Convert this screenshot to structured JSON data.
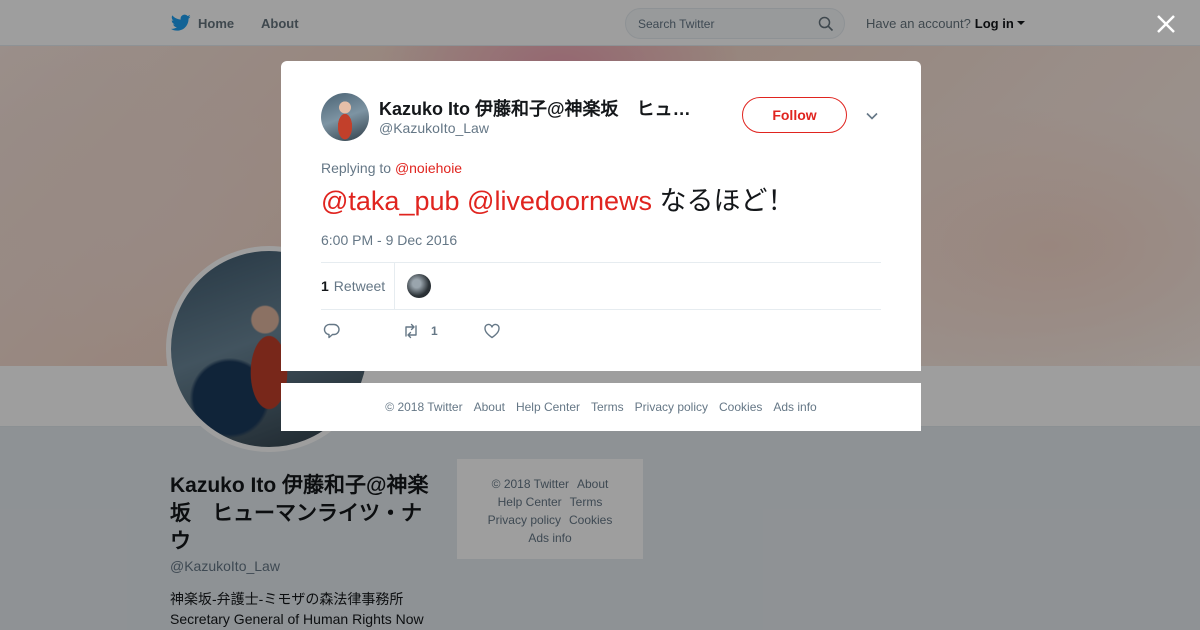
{
  "topbar": {
    "home_label": "Home",
    "about_label": "About",
    "search_placeholder": "Search Twitter",
    "have_account": "Have an account?",
    "login_label": "Log in"
  },
  "profile": {
    "name": "Kazuko Ito 伊藤和子@神楽坂　ヒューマンライツ・ナウ",
    "handle": "@KazukoIto_Law",
    "bio_line1": "神楽坂-弁護士-ミモザの森法律事務所",
    "bio_line2": "Secretary General of Human Rights Now"
  },
  "side_footer": {
    "copyright": "© 2018 Twitter",
    "about": "About",
    "help": "Help Center",
    "terms": "Terms",
    "privacy": "Privacy policy",
    "cookies": "Cookies",
    "ads": "Ads info"
  },
  "tweet": {
    "author_name": "Kazuko Ito 伊藤和子@神楽坂　ヒューマンライツ・ナウ",
    "author_handle": "@KazukoIto_Law",
    "follow_label": "Follow",
    "replying_prefix": "Replying to",
    "replying_to": "@noiehoie",
    "mention1": "@taka_pub",
    "mention2": "@livedoornews",
    "text": "なるほど！",
    "timestamp": "6:00 PM - 9 Dec 2016",
    "retweet_count": "1",
    "retweet_label": "Retweet",
    "action_retweet_count": "1"
  },
  "modal_footer": {
    "copyright": "© 2018 Twitter",
    "about": "About",
    "help": "Help Center",
    "terms": "Terms",
    "privacy": "Privacy policy",
    "cookies": "Cookies",
    "ads": "Ads info"
  },
  "colors": {
    "accent": "#e0241f",
    "muted": "#657786",
    "brand_bird": "#1da1f2"
  }
}
